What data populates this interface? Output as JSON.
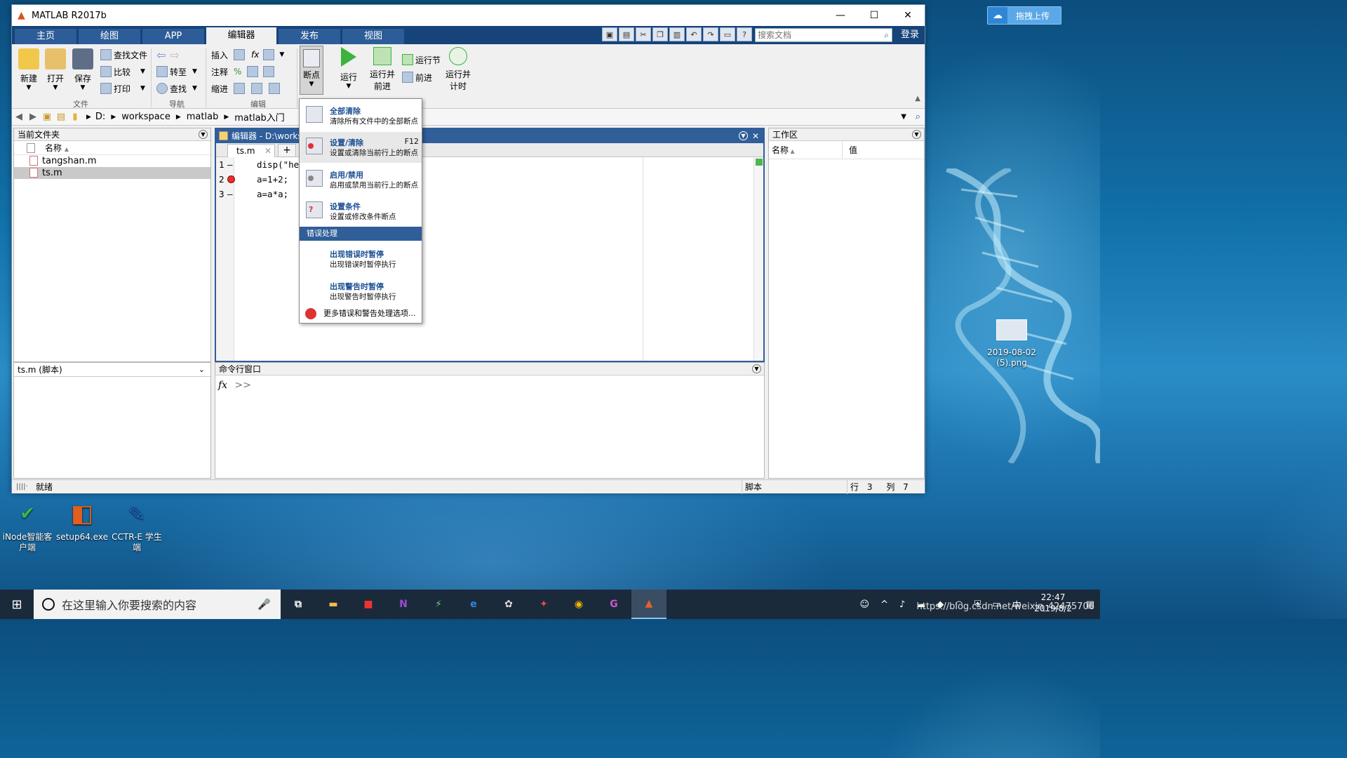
{
  "matlab": {
    "title": "MATLAB R2017b",
    "tabs": [
      "主页",
      "绘图",
      "APP",
      "编辑器",
      "发布",
      "视图"
    ],
    "active_tab": "编辑器",
    "search_placeholder": "搜索文档",
    "login": "登录",
    "ribbon": {
      "file_group": {
        "label": "文件",
        "new": "新建",
        "open": "打开",
        "save": "保存",
        "find_files": "查找文件",
        "compare": "比较",
        "print": "打印"
      },
      "nav_group": {
        "label": "导航",
        "goto": "转至",
        "find": "查找"
      },
      "edit_group": {
        "label": "编辑",
        "insert": "插入",
        "comment": "注释",
        "indent": "缩进"
      },
      "breakpoints": "断点",
      "run": "运行",
      "run_advance_1": "运行并",
      "run_advance_2": "前进",
      "run_section": "运行节",
      "advance": "前进",
      "run_time_1": "运行并",
      "run_time_2": "计时"
    },
    "path": [
      "D:",
      "workspace",
      "matlab",
      "matlab入门"
    ],
    "current_folder": {
      "title": "当前文件夹",
      "column": "名称",
      "files": [
        {
          "name": "tangshan.m",
          "selected": false
        },
        {
          "name": "ts.m",
          "selected": true
        }
      ]
    },
    "details": {
      "title": "ts.m  (脚本)"
    },
    "editor": {
      "title": "编辑器 - D:\\works",
      "tab": "ts.m",
      "lines": [
        {
          "num": "1",
          "code": "disp(\"hel",
          "breakpoint": false
        },
        {
          "num": "2",
          "code": "a=1+2;",
          "breakpoint": true
        },
        {
          "num": "3",
          "code": "a=a*a;",
          "breakpoint": false
        }
      ]
    },
    "command_window": {
      "title": "命令行窗口",
      "fx": "fx",
      "prompt": ">>"
    },
    "workspace": {
      "title": "工作区",
      "col_name": "名称",
      "col_value": "值"
    },
    "breakpoint_menu": {
      "items": [
        {
          "title": "全部清除",
          "desc": "清除所有文件中的全部断点",
          "key": ""
        },
        {
          "title": "设置/清除",
          "desc": "设置或清除当前行上的断点",
          "key": "F12"
        },
        {
          "title": "启用/禁用",
          "desc": "启用或禁用当前行上的断点",
          "key": ""
        },
        {
          "title": "设置条件",
          "desc": "设置或修改条件断点",
          "key": ""
        }
      ],
      "section": "错误处理",
      "error_items": [
        {
          "title": "出现错误时暂停",
          "desc": "出现错误时暂停执行"
        },
        {
          "title": "出现警告时暂停",
          "desc": "出现警告时暂停执行"
        }
      ],
      "more": "更多错误和警告处理选项..."
    },
    "status": {
      "text": "就绪",
      "type": "脚本",
      "row_label": "行",
      "row": "3",
      "col_label": "列",
      "col": "7"
    }
  },
  "desktop": {
    "upload": "拖拽上传",
    "png_icon": "2019-08-02\n(5).png",
    "icons": [
      {
        "label": "iNode智能客户端"
      },
      {
        "label": "setup64.exe"
      },
      {
        "label": "CCTR-E 学生端"
      }
    ]
  },
  "taskbar": {
    "search_placeholder": "在这里输入你要搜索的内容",
    "time": "22:47",
    "date": "2019/8/2",
    "ime": "中",
    "watermark": "https://blog.csdn.net/weixin_42475706"
  }
}
